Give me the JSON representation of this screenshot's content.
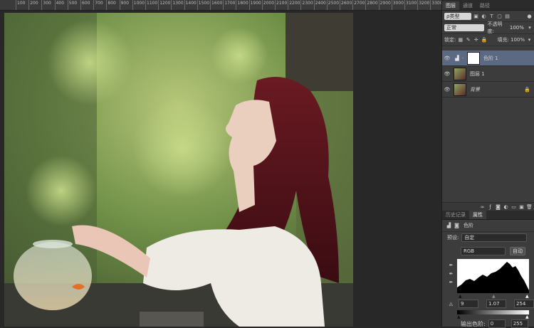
{
  "ruler": {
    "ticks": [
      "100",
      "200",
      "300",
      "400",
      "500",
      "600",
      "700",
      "800",
      "900",
      "1000",
      "1100",
      "1200",
      "1300",
      "1400",
      "1500",
      "1600",
      "1700",
      "1800",
      "1900",
      "2000",
      "2100",
      "2200",
      "2300",
      "2400",
      "2500",
      "2600",
      "2700",
      "2800",
      "2900",
      "3000",
      "3100",
      "3200",
      "3300"
    ]
  },
  "layers_panel": {
    "tabs": [
      "图层",
      "通道",
      "路径"
    ],
    "kind_filter": "ρ类型",
    "blend_mode": "正常",
    "opacity_label": "不透明度:",
    "opacity_value": "100%",
    "lock_label": "锁定:",
    "fill_label": "填充:",
    "fill_value": "100%",
    "layers": [
      {
        "name": "色阶 1",
        "selected": true
      },
      {
        "name": "图层 1",
        "selected": false
      },
      {
        "name": "背景",
        "selected": false,
        "locked": true
      }
    ]
  },
  "properties_panel": {
    "tabs": [
      "历史记录",
      "属性"
    ],
    "title": "色阶",
    "preset_label": "预设:",
    "preset_value": "自定",
    "channel_value": "RGB",
    "auto_button": "自动",
    "input_black": "9",
    "input_gamma": "1.07",
    "input_white": "254",
    "output_label": "输出色阶:",
    "output_black": "0",
    "output_white": "255"
  },
  "colors": {
    "selected_layer": "#5b6a82",
    "panel_bg": "#3c3c3c"
  }
}
